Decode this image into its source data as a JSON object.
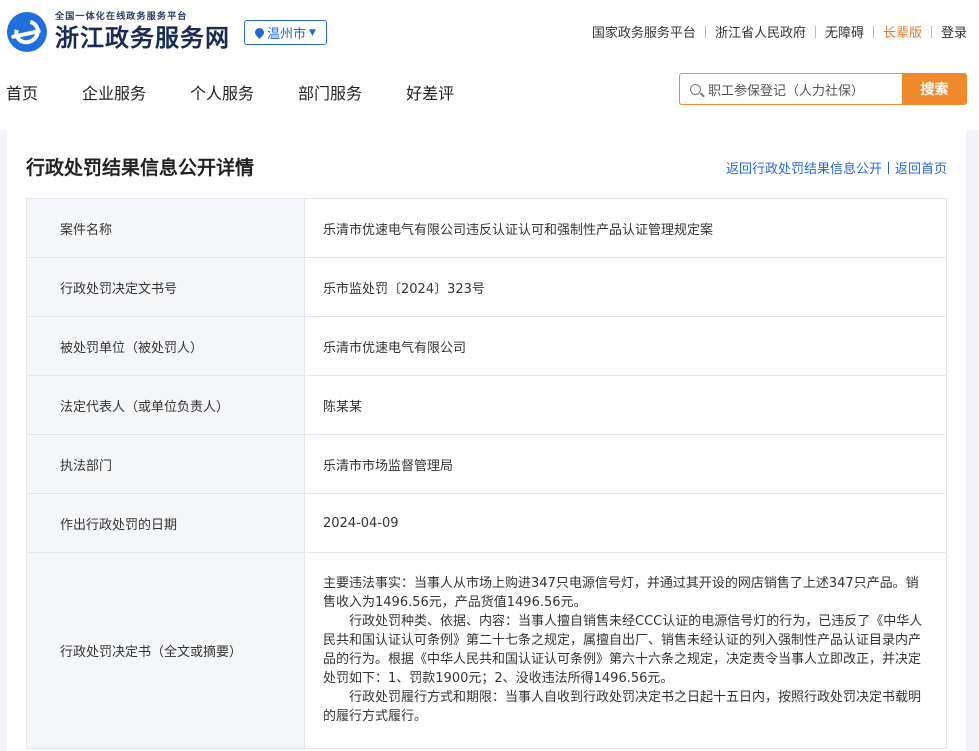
{
  "header": {
    "logo_sub": "全国一体化在线政务服务平台",
    "logo_main": "浙江政务服务网",
    "city": "温州市",
    "links": [
      "国家政务服务平台",
      "浙江省人民政府",
      "无障碍",
      "长辈版",
      "登录"
    ]
  },
  "nav": [
    "首页",
    "企业服务",
    "个人服务",
    "部门服务",
    "好差评"
  ],
  "search": {
    "placeholder": "职工参保登记（人力社保）",
    "button": "搜索"
  },
  "page": {
    "title": "行政处罚结果信息公开详情",
    "back_link": "返回行政处罚结果信息公开",
    "home_link": "返回首页"
  },
  "details": [
    {
      "label": "案件名称",
      "value": "乐清市优速电气有限公司违反认证认可和强制性产品认证管理规定案"
    },
    {
      "label": "行政处罚决定文书号",
      "value": "乐市监处罚〔2024〕323号"
    },
    {
      "label": "被处罚单位（被处罚人）",
      "value": "乐清市优速电气有限公司"
    },
    {
      "label": "法定代表人（或单位负责人）",
      "value": "陈某某"
    },
    {
      "label": "执法部门",
      "value": "乐清市市场监督管理局"
    },
    {
      "label": "作出行政处罚的日期",
      "value": "2024-04-09"
    }
  ],
  "decision": {
    "label": "行政处罚决定书（全文或摘要）",
    "paragraphs": [
      "主要违法事实：当事人从市场上购进347只电源信号灯，并通过其开设的网店销售了上述347只产品。销售收入为1496.56元，产品货值1496.56元。",
      "行政处罚种类、依据、内容：当事人擅自销售未经CCC认证的电源信号灯的行为，已违反了《中华人民共和国认证认可条例》第二十七条之规定，属擅自出厂、销售未经认证的列入强制性产品认证目录内产品的行为。根据《中华人民共和国认证认可条例》第六十六条之规定，决定责令当事人立即改正，并决定处罚如下：1、罚款1900元；2、没收违法所得1496.56元。",
      "行政处罚履行方式和期限：当事人自收到行政处罚决定书之日起十五日内，按照行政处罚决定书载明的履行方式履行。"
    ]
  }
}
